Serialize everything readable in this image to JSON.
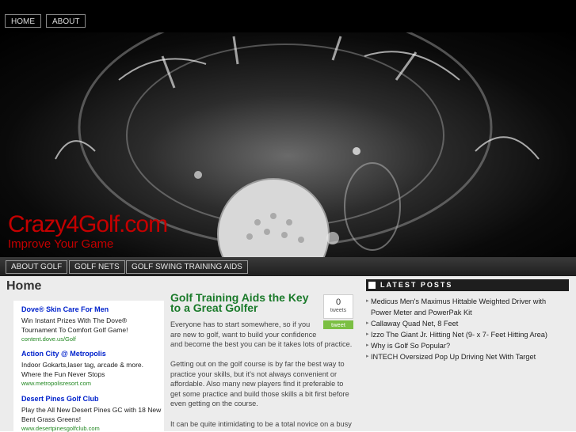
{
  "top_nav": {
    "items": [
      "HOME",
      "ABOUT"
    ]
  },
  "site": {
    "title": "Crazy4Golf.com",
    "tagline": "Improve Your Game"
  },
  "category_nav": {
    "items": [
      "ABOUT GOLF",
      "GOLF NETS",
      "GOLF SWING TRAINING AIDS"
    ]
  },
  "page": {
    "title": "Home"
  },
  "ads": [
    {
      "title": "Dove® Skin Care For Men",
      "lines": [
        "Win Instant Prizes With The Dove®",
        "Tournament To Comfort Golf Game!"
      ],
      "url": "content.dove.us/Golf"
    },
    {
      "title": "Action City @ Metropolis",
      "lines": [
        "Indoor Gokarts,laser tag, arcade & more.",
        "Where the Fun Never Stops"
      ],
      "url": "www.metropolisresort.com"
    },
    {
      "title": "Desert Pines Golf Club",
      "lines": [
        "Play the All New Desert Pines GC with 18 New",
        "Bent Grass Greens!"
      ],
      "url": "www.desertpinesgolfclub.com"
    }
  ],
  "post": {
    "title_lines": [
      "Golf Training Aids the Key",
      "to a Great Golfer"
    ],
    "tweet_count": "0",
    "tweet_count_label": "tweets",
    "tweet_button": "tweet",
    "paragraphs": [
      [
        "Everyone has to start somewhere, so if you",
        "are new to golf, want to build your confidence",
        "and become the best you can be it takes lots of practice."
      ],
      [
        "Getting out on the golf course is by far the best way to",
        "practice your skills, but it's not always convenient or",
        "affordable. Also many new players find it preferable to",
        "get some practice and build those skills a bit first before",
        "even getting on the course."
      ],
      [
        "It can be quite intimidating to be a total novice on a busy"
      ]
    ]
  },
  "sidebar": {
    "heading": "LATEST POSTS",
    "items": [
      [
        "Medicus Men's Maximus Hittable Weighted Driver with",
        "Power Meter and PowerPak Kit"
      ],
      [
        "Callaway Quad Net, 8 Feet"
      ],
      [
        "Izzo The Giant Jr. Hitting Net (9- x 7- Feet Hitting Area)"
      ],
      [
        "Why is Golf So Popular?"
      ],
      [
        "INTECH Oversized Pop Up Driving Net With Target"
      ]
    ]
  }
}
